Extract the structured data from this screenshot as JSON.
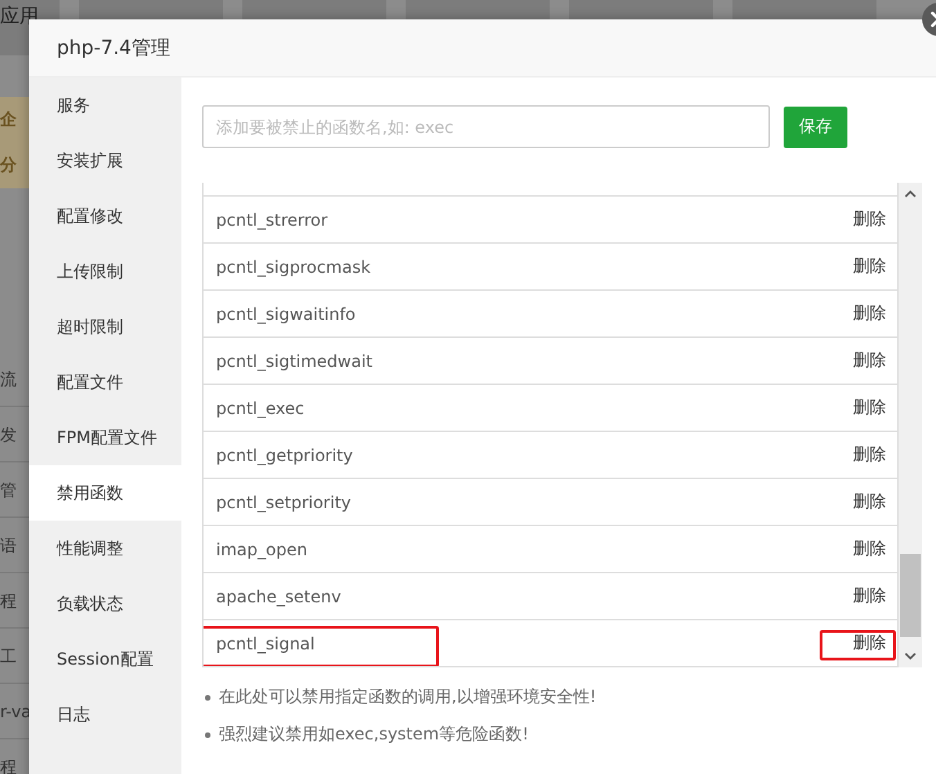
{
  "background": {
    "tabs": [
      "应用"
    ],
    "side_items": [
      "企",
      "分",
      "流",
      "发",
      "管",
      "语",
      "程",
      "工",
      "r-va",
      "程"
    ]
  },
  "dialog": {
    "title": "php-7.4管理"
  },
  "sidebar": {
    "items": [
      {
        "label": "服务",
        "selected": false
      },
      {
        "label": "安装扩展",
        "selected": false
      },
      {
        "label": "配置修改",
        "selected": false
      },
      {
        "label": "上传限制",
        "selected": false
      },
      {
        "label": "超时限制",
        "selected": false
      },
      {
        "label": "配置文件",
        "selected": false
      },
      {
        "label": "FPM配置文件",
        "selected": false
      },
      {
        "label": "禁用函数",
        "selected": true
      },
      {
        "label": "性能调整",
        "selected": false
      },
      {
        "label": "负载状态",
        "selected": false
      },
      {
        "label": "Session配置",
        "selected": false
      },
      {
        "label": "日志",
        "selected": false
      }
    ]
  },
  "input": {
    "placeholder": "添加要被禁止的函数名,如: exec"
  },
  "save_button": "保存",
  "functions": [
    {
      "name": "pcntl_strerror",
      "action": "删除",
      "highlighted": false
    },
    {
      "name": "pcntl_sigprocmask",
      "action": "删除",
      "highlighted": false
    },
    {
      "name": "pcntl_sigwaitinfo",
      "action": "删除",
      "highlighted": false
    },
    {
      "name": "pcntl_sigtimedwait",
      "action": "删除",
      "highlighted": false
    },
    {
      "name": "pcntl_exec",
      "action": "删除",
      "highlighted": false
    },
    {
      "name": "pcntl_getpriority",
      "action": "删除",
      "highlighted": false
    },
    {
      "name": "pcntl_setpriority",
      "action": "删除",
      "highlighted": false
    },
    {
      "name": "imap_open",
      "action": "删除",
      "highlighted": false
    },
    {
      "name": "apache_setenv",
      "action": "删除",
      "highlighted": false
    },
    {
      "name": "pcntl_signal",
      "action": "删除",
      "highlighted": true
    }
  ],
  "notes": [
    "在此处可以禁用指定函数的调用,以增强环境安全性!",
    "强烈建议禁用如exec,system等危险函数!"
  ]
}
